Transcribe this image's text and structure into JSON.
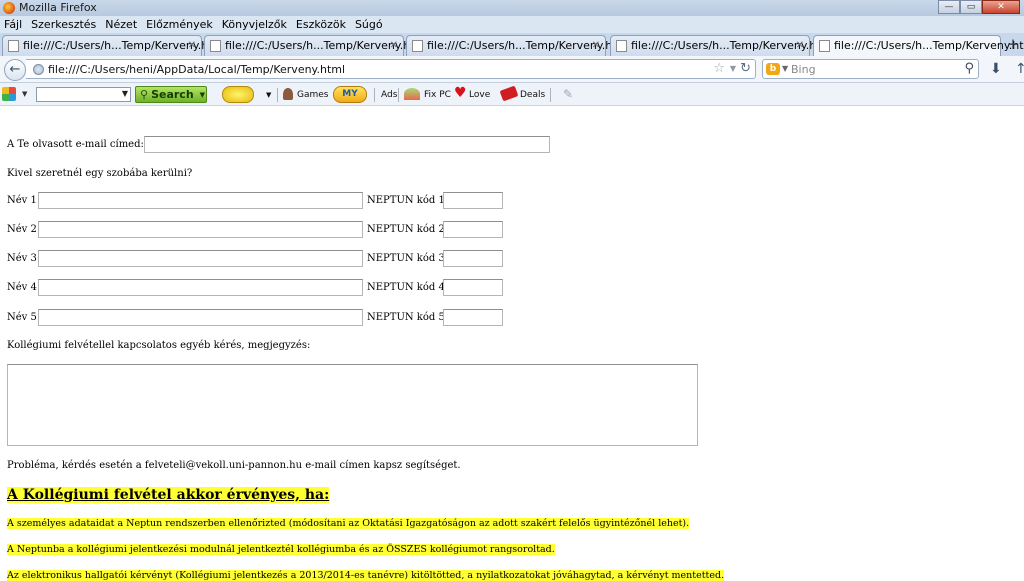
{
  "window": {
    "title": "Mozilla Firefox"
  },
  "menu": [
    "Fájl",
    "Szerkesztés",
    "Nézet",
    "Előzmények",
    "Könyvjelzők",
    "Eszközök",
    "Súgó"
  ],
  "tabs": [
    "file:///C:/Users/h...Temp/Kerveny.html",
    "file:///C:/Users/h...Temp/Kerveny.html",
    "file:///C:/Users/h...Temp/Kerveny.html",
    "file:///C:/Users/h...Temp/Kerveny.html",
    "file:///C:/Users/h...Temp/Kerveny.html"
  ],
  "nav": {
    "url": "file:///C:/Users/heni/AppData/Local/Temp/Kerveny.html",
    "search_placeholder": "Bing"
  },
  "toolbar": {
    "search": "Search",
    "games": "Games",
    "my": "MY",
    "ads": "Ads",
    "fixpc": "Fix PC",
    "love": "Love",
    "deals": "Deals"
  },
  "icons": [
    "back-arrow-icon",
    "globe-icon",
    "star-icon",
    "reload-icon",
    "bing-icon",
    "search-icon",
    "download-icon",
    "apps-icon",
    "smiley-icon",
    "games-icon",
    "heart-icon",
    "deals-icon",
    "pen-icon"
  ],
  "form": {
    "email_label": "A Te olvasott e-mail címed:",
    "roommate_question": "Kivel szeretnél egy szobába kerülni?",
    "rows": [
      {
        "name_label": "Név 1:",
        "neptun_label": "NEPTUN kód 1:"
      },
      {
        "name_label": "Név 2:",
        "neptun_label": "NEPTUN kód 2:"
      },
      {
        "name_label": "Név 3:",
        "neptun_label": "NEPTUN kód 3:"
      },
      {
        "name_label": "Név 4:",
        "neptun_label": "NEPTUN kód 4:"
      },
      {
        "name_label": "Név 5:",
        "neptun_label": "NEPTUN kód 5:"
      }
    ],
    "comment_label": "Kollégiumi felvétellel kapcsolatos egyéb kérés, megjegyzés:",
    "help_text": "Probléma, kérdés esetén a felveteli@vekoll.uni-pannon.hu e-mail címen kapsz segítséget."
  },
  "conditions": {
    "heading": "A Kollégiumi felvétel akkor érvényes, ha:",
    "items": [
      "A személyes adataidat a Neptun rendszerben ellenőrizted (módosítani az Oktatási Igazgatóságon az adott szakért felelős ügyintézőnél lehet).",
      "A Neptunba a kollégiumi jelentkezési modulnál jelentkeztél kollégiumba és az ÖSSZES kollégiumot rangsoroltad.",
      "Az elektronikus hallgatói kérvényt (Kollégiumi jelentkezés a 2013/2014-es tanévre) kitöltötted, a nyilatkozatokat jóváhagytad, a kérvényt mentetted."
    ]
  },
  "colors": {
    "highlight": "#ffff33",
    "search_button": "#8cc63f"
  }
}
